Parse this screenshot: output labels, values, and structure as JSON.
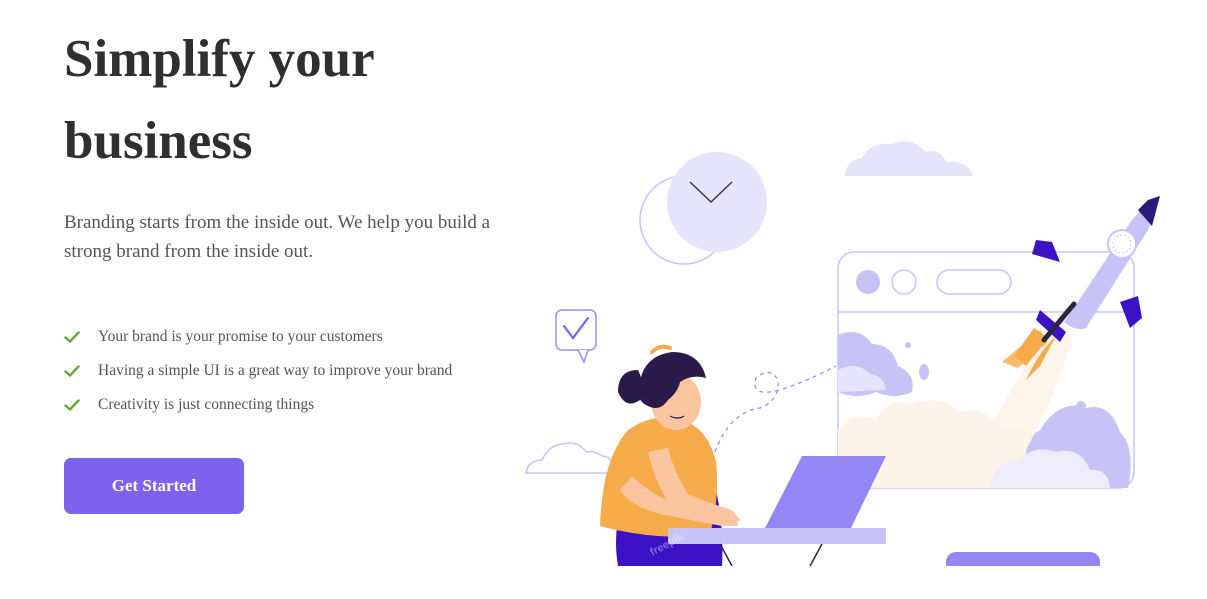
{
  "hero": {
    "title_line1": "Simplify your",
    "title_line2": "business",
    "description": "Branding starts from the inside out. We help you build a strong brand from the inside out.",
    "features": [
      "Your brand is your promise to your customers",
      "Having a simple UI is a great way to improve your brand",
      "Creativity is just connecting things"
    ],
    "cta_label": "Get Started"
  },
  "illustration": {
    "icons": [
      "clock-icon",
      "chat-check-icon",
      "rocket-icon",
      "browser-window-icon",
      "laptop-icon",
      "cloud-icon"
    ],
    "watermark": "freepik"
  },
  "colors": {
    "title": "#2f2f2f",
    "text": "#555555",
    "accent": "#7c62ec",
    "check": "#6aa536",
    "lavender": "#c8c3f7",
    "indigo": "#3d12c6",
    "orange": "#f6ab4b"
  }
}
